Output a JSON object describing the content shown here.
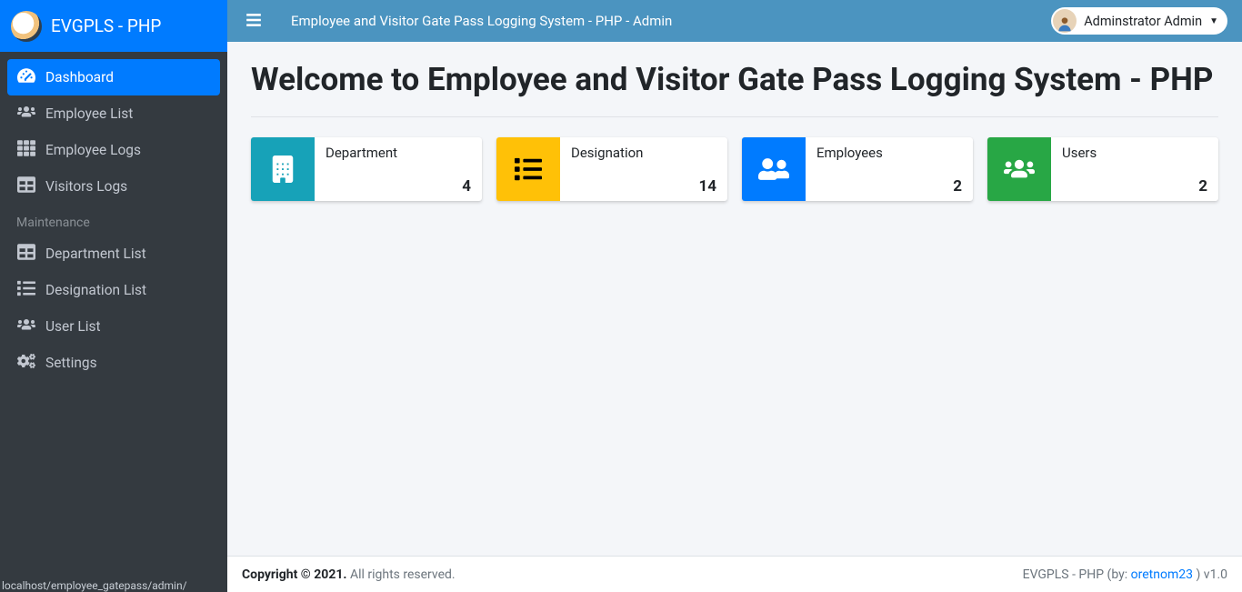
{
  "brand": {
    "text": "EVGPLS - PHP"
  },
  "topnav": {
    "title": "Employee and Visitor Gate Pass Logging System - PHP - Admin",
    "user_label": "Adminstrator Admin"
  },
  "sidebar": {
    "items": [
      {
        "label": "Dashboard"
      },
      {
        "label": "Employee List"
      },
      {
        "label": "Employee Logs"
      },
      {
        "label": "Visitors Logs"
      }
    ],
    "maintenance_header": "Maintenance",
    "maint_items": [
      {
        "label": "Department List"
      },
      {
        "label": "Designation List"
      },
      {
        "label": "User List"
      },
      {
        "label": "Settings"
      }
    ]
  },
  "page": {
    "title": "Welcome to Employee and Visitor Gate Pass Logging System - PHP"
  },
  "cards": [
    {
      "label": "Department",
      "value": "4"
    },
    {
      "label": "Designation",
      "value": "14"
    },
    {
      "label": "Employees",
      "value": "2"
    },
    {
      "label": "Users",
      "value": "2"
    }
  ],
  "footer": {
    "copyright_strong": "Copyright © 2021.",
    "copyright_rest": " All rights reserved.",
    "right_prefix": "EVGPLS - PHP (by: ",
    "right_link": "oretnom23",
    "right_suffix": " ) v1.0"
  },
  "status_url": "localhost/employee_gatepass/admin/"
}
